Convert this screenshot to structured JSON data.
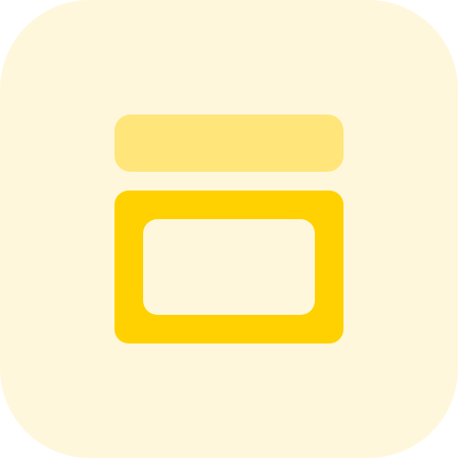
{
  "icon": {
    "semantic": "jar-icon",
    "colors": {
      "background": "#FFF7DC",
      "lid": "#FFE57A",
      "body": "#FFD100",
      "label": "#FFF7DC"
    }
  }
}
